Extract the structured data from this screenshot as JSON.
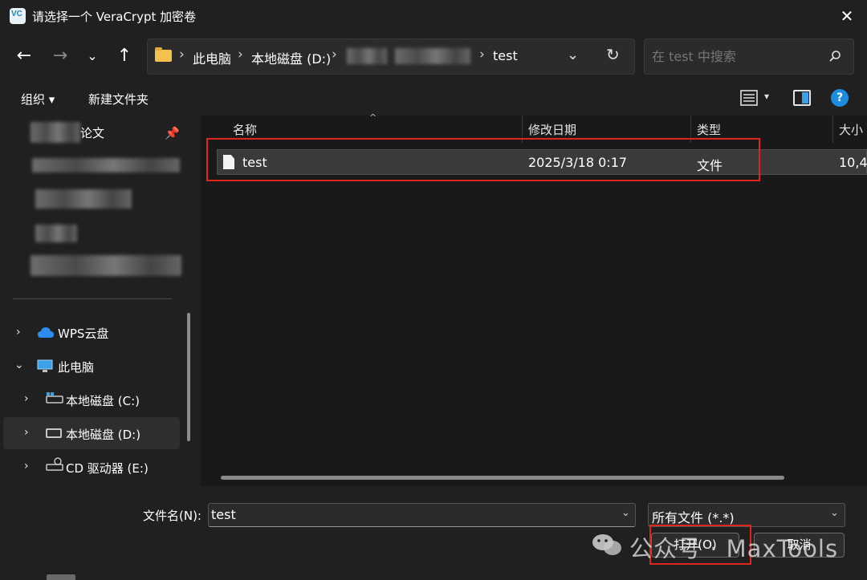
{
  "window": {
    "title": "请选择一个 VeraCrypt 加密卷",
    "close_glyph": "✕"
  },
  "nav": {
    "back_glyph": "←",
    "forward_glyph": "→",
    "recent_glyph": "⌄",
    "up_glyph": "↑",
    "breadcrumbs": [
      "此电脑",
      "本地磁盘 (D:)",
      "test"
    ],
    "separator": "›",
    "dropdown_glyph": "⌄",
    "refresh_glyph": "↻"
  },
  "search": {
    "placeholder": "在 test 中搜索"
  },
  "toolbar": {
    "organize_label": "组织 ▾",
    "new_folder_label": "新建文件夹",
    "view_dropdown_glyph": "▾",
    "help_glyph": "?"
  },
  "sidebar": {
    "pinned_item_label": "论文",
    "pin_glyph": "📌",
    "items": [
      {
        "label": "WPS云盘",
        "chevron": "›",
        "icon": "cloud-icon"
      },
      {
        "label": "此电脑",
        "chevron": "⌄",
        "icon": "computer-icon"
      },
      {
        "label": "本地磁盘 (C:)",
        "chevron": "›",
        "icon": "drive-icon"
      },
      {
        "label": "本地磁盘 (D:)",
        "chevron": "›",
        "icon": "drive-icon"
      },
      {
        "label": "CD 驱动器 (E:)",
        "chevron": "›",
        "icon": "cd-drive-icon"
      }
    ]
  },
  "file_list": {
    "columns": [
      "名称",
      "修改日期",
      "类型",
      "大小"
    ],
    "sort_glyph": "^",
    "rows": [
      {
        "name": "test",
        "modified": "2025/3/18 0:17",
        "type": "文件",
        "size": "10,4"
      }
    ]
  },
  "footer": {
    "filename_label": "文件名(N):",
    "filename_value": "test",
    "filetype_value": "所有文件 (*.*)",
    "dropdown_glyph": "⌄",
    "open_label": "打开(O)",
    "cancel_label": "取消"
  },
  "watermark": {
    "text": "公众号 · MaxTools"
  },
  "colors": {
    "highlight": "#e0251b",
    "accent": "#1c8ce0",
    "folder": "#f2c14e"
  }
}
